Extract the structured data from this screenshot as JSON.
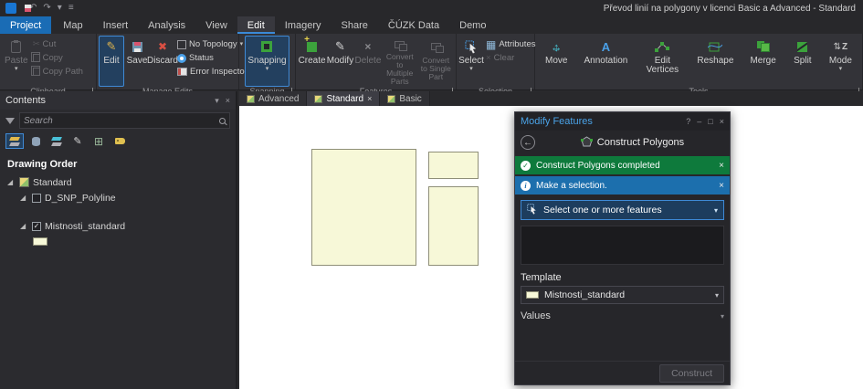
{
  "title_bar": {
    "title": "Převod linií na polygony v licenci Basic a Advanced - Standard"
  },
  "ribbon_tabs": {
    "project": "Project",
    "map": "Map",
    "insert": "Insert",
    "analysis": "Analysis",
    "view": "View",
    "edit": "Edit",
    "imagery": "Imagery",
    "share": "Share",
    "cuzk": "ČÚZK Data",
    "demo": "Demo"
  },
  "ribbon": {
    "clipboard": {
      "label": "Clipboard",
      "paste": "Paste",
      "cut": "Cut",
      "copy": "Copy",
      "copy_path": "Copy Path"
    },
    "manage_edits": {
      "label": "Manage Edits",
      "edit": "Edit",
      "save": "Save",
      "discard": "Discard",
      "topology": "No Topology",
      "status": "Status",
      "error_inspector": "Error Inspector"
    },
    "snapping": {
      "label": "Snapping",
      "snapping": "Snapping"
    },
    "features": {
      "label": "Features",
      "create": "Create",
      "modify": "Modify",
      "delete": "Delete",
      "convert_multiple": "Convert to Multiple Parts",
      "convert_single": "Convert to Single Part"
    },
    "selection": {
      "label": "Selection",
      "select": "Select",
      "attributes": "Attributes",
      "clear": "Clear"
    },
    "tools": {
      "label": "Tools",
      "move": "Move",
      "annotation": "Annotation",
      "edit_vertices": "Edit Vertices",
      "reshape": "Reshape",
      "merge": "Merge",
      "split": "Split",
      "mode": "Mode"
    }
  },
  "contents": {
    "title": "Contents",
    "search_placeholder": "Search",
    "drawing_order": "Drawing Order",
    "map_name": "Standard",
    "layer1": "D_SNP_Polyline",
    "layer2": "Mistnosti_standard"
  },
  "map_tabs": {
    "advanced": "Advanced",
    "standard": "Standard",
    "basic": "Basic"
  },
  "modify_panel": {
    "title": "Modify Features",
    "tool_title": "Construct Polygons",
    "success_message": "Construct Polygons completed",
    "info_message": "Make a selection.",
    "selection_prompt": "Select one or more features",
    "template_label": "Template",
    "template_value": "Mistnosti_standard",
    "values_label": "Values",
    "construct_button": "Construct"
  },
  "icons": {
    "close": "×",
    "caret_down": "▾",
    "help": "?",
    "minimize": "–",
    "float": "□",
    "back_arrow": "←",
    "check": "✓",
    "info": "i",
    "cut": "✂",
    "pencil": "✎",
    "discard": "✖",
    "undo": "↶",
    "redo": "↷",
    "menu": "≡",
    "annotation": "A",
    "mode_letter": "Z",
    "mode_arrows": "⇅",
    "attributes": "▦",
    "delete": "×",
    "clear": "×",
    "arrow_h": "↔",
    "arrow_v": "↕",
    "tree_caret": "◢",
    "grid": "⊞"
  },
  "colors": {
    "accent_blue": "#3a8ad8",
    "success_green": "#0e7a3c",
    "info_blue": "#1c6fad",
    "polygon_fill": "#f7f8d8",
    "polygon_border": "#8f8f78"
  }
}
